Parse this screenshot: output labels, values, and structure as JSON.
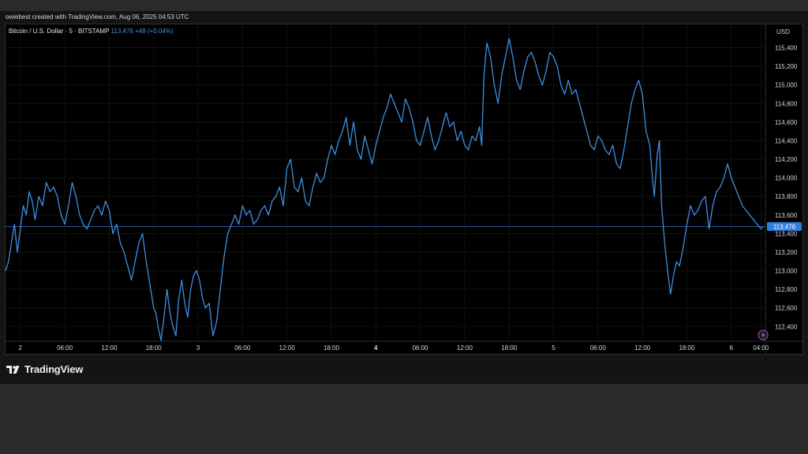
{
  "header": {
    "credit": "owiebest created with TradingView.com, Aug 06, 2025 04:53 UTC"
  },
  "legend": {
    "symbol": "Bitcoin / U.S. Dollar · 5 · BITSTAMP",
    "last": "113,476",
    "change": "+48 (+0.04%)"
  },
  "logo": {
    "brand": "TradingView",
    "icon": "tradingview-logo-icon"
  },
  "colors": {
    "line": "#3d8fe0",
    "price_tag": "#2f7fe0",
    "background": "#000000"
  },
  "chart_data": {
    "type": "line",
    "currency": "USD",
    "last_price": 113476,
    "last_price_label": "113,476",
    "ylim": [
      112250,
      115650
    ],
    "y_ticks": [
      {
        "value": 115400,
        "label": "115,400"
      },
      {
        "value": 115200,
        "label": "115,200"
      },
      {
        "value": 115000,
        "label": "115,000"
      },
      {
        "value": 114800,
        "label": "114,800"
      },
      {
        "value": 114600,
        "label": "114,600"
      },
      {
        "value": 114400,
        "label": "114,400"
      },
      {
        "value": 114200,
        "label": "114,200"
      },
      {
        "value": 114000,
        "label": "114,000"
      },
      {
        "value": 113800,
        "label": "113,800"
      },
      {
        "value": 113600,
        "label": "113,600"
      },
      {
        "value": 113400,
        "label": "113,400"
      },
      {
        "value": 113200,
        "label": "113,200"
      },
      {
        "value": 113000,
        "label": "113,000"
      },
      {
        "value": 112800,
        "label": "112,800"
      },
      {
        "value": 112600,
        "label": "112,600"
      },
      {
        "value": 112400,
        "label": "112,400"
      }
    ],
    "xlim": [
      -2,
      100.5
    ],
    "x_ticks": [
      {
        "value": 0,
        "label": "2",
        "bold": false
      },
      {
        "value": 6,
        "label": "06:00",
        "bold": false
      },
      {
        "value": 12,
        "label": "12:00",
        "bold": false
      },
      {
        "value": 18,
        "label": "18:00",
        "bold": false
      },
      {
        "value": 24,
        "label": "3",
        "bold": false
      },
      {
        "value": 30,
        "label": "06:00",
        "bold": false
      },
      {
        "value": 36,
        "label": "12:00",
        "bold": false
      },
      {
        "value": 42,
        "label": "18:00",
        "bold": false
      },
      {
        "value": 48,
        "label": "4",
        "bold": true
      },
      {
        "value": 54,
        "label": "06:00",
        "bold": false
      },
      {
        "value": 60,
        "label": "12:00",
        "bold": false
      },
      {
        "value": 66,
        "label": "18:00",
        "bold": false
      },
      {
        "value": 72,
        "label": "5",
        "bold": false
      },
      {
        "value": 78,
        "label": "06:00",
        "bold": false
      },
      {
        "value": 84,
        "label": "12:00",
        "bold": false
      },
      {
        "value": 90,
        "label": "18:00",
        "bold": false
      },
      {
        "value": 96,
        "label": "6",
        "bold": false
      },
      {
        "value": 100,
        "label": "04:00",
        "bold": false
      }
    ],
    "series": [
      {
        "x": [
          -2,
          -1.6,
          -1.2,
          -0.8,
          -0.4,
          0,
          0.4,
          0.8,
          1.2,
          1.6,
          2,
          2.5,
          3,
          3.5,
          4,
          4.5,
          5,
          5.5,
          6,
          6.5,
          7,
          7.5,
          8,
          8.5,
          9,
          9.5,
          10,
          10.5,
          11,
          11.5,
          12,
          12.5,
          13,
          13.5,
          14,
          14.5,
          15,
          15.5,
          16,
          16.5,
          17,
          17.5,
          18,
          18.3,
          18.6,
          19,
          19.4,
          19.8,
          20.2,
          20.6,
          21,
          21.4,
          21.8,
          22.2,
          22.6,
          23,
          23.4,
          23.8,
          24.2,
          24.6,
          25,
          25.5,
          26,
          26.5,
          27,
          27.5,
          28,
          28.5,
          29,
          29.5,
          30,
          30.5,
          31,
          31.5,
          32,
          32.5,
          33,
          33.5,
          34,
          34.5,
          35,
          35.5,
          36,
          36.5,
          37,
          37.5,
          38,
          38.5,
          39,
          39.5,
          40,
          40.5,
          41,
          41.5,
          42,
          42.5,
          43,
          43.5,
          44,
          44.5,
          45,
          45.5,
          46,
          46.5,
          47,
          47.5,
          48,
          48.5,
          49,
          49.5,
          50,
          50.5,
          51,
          51.5,
          52,
          52.5,
          53,
          53.5,
          54,
          54.5,
          55,
          55.5,
          56,
          56.5,
          57,
          57.5,
          58,
          58.5,
          59,
          59.5,
          60,
          60.5,
          61,
          61.5,
          62,
          62.3,
          62.6,
          63,
          63.5,
          64,
          64.5,
          65,
          65.5,
          66,
          66.5,
          67,
          67.5,
          68,
          68.5,
          69,
          69.5,
          70,
          70.5,
          71,
          71.5,
          72,
          72.5,
          73,
          73.5,
          74,
          74.5,
          75,
          75.5,
          76,
          76.5,
          77,
          77.5,
          78,
          78.5,
          79,
          79.5,
          80,
          80.5,
          81,
          81.5,
          82,
          82.5,
          83,
          83.5,
          84,
          84.5,
          85,
          85.3,
          85.6,
          86,
          86.3,
          86.6,
          87,
          87.4,
          87.8,
          88.2,
          88.6,
          89,
          89.5,
          90,
          90.5,
          91,
          91.5,
          92,
          92.5,
          93,
          93.5,
          94,
          94.5,
          95,
          95.5,
          96,
          96.5,
          97,
          97.5,
          98,
          98.5,
          99,
          99.5,
          100,
          100.3
        ],
        "y": [
          113000,
          113100,
          113300,
          113500,
          113200,
          113450,
          113700,
          113600,
          113850,
          113750,
          113550,
          113800,
          113700,
          113950,
          113850,
          113900,
          113800,
          113600,
          113500,
          113700,
          113950,
          113800,
          113600,
          113500,
          113450,
          113550,
          113650,
          113700,
          113600,
          113750,
          113650,
          113400,
          113500,
          113300,
          113200,
          113050,
          112900,
          113100,
          113300,
          113400,
          113100,
          112850,
          112600,
          112550,
          112400,
          112250,
          112500,
          112800,
          112550,
          112400,
          112300,
          112700,
          112900,
          112650,
          112500,
          112800,
          112950,
          113000,
          112900,
          112700,
          112600,
          112650,
          112300,
          112450,
          112800,
          113150,
          113400,
          113500,
          113600,
          113500,
          113700,
          113600,
          113650,
          113500,
          113550,
          113650,
          113700,
          113600,
          113750,
          113800,
          113900,
          113700,
          114100,
          114200,
          113900,
          113850,
          114000,
          113750,
          113700,
          113900,
          114050,
          113950,
          114000,
          114200,
          114350,
          114250,
          114400,
          114500,
          114650,
          114350,
          114600,
          114300,
          114200,
          114450,
          114300,
          114150,
          114350,
          114500,
          114650,
          114750,
          114900,
          114800,
          114700,
          114600,
          114850,
          114750,
          114600,
          114400,
          114350,
          114500,
          114650,
          114450,
          114300,
          114400,
          114550,
          114700,
          114550,
          114600,
          114400,
          114500,
          114350,
          114300,
          114450,
          114400,
          114550,
          114350,
          115100,
          115450,
          115300,
          115000,
          114800,
          115100,
          115300,
          115500,
          115300,
          115050,
          114950,
          115150,
          115300,
          115350,
          115250,
          115100,
          115000,
          115150,
          115350,
          115300,
          115200,
          115000,
          114900,
          115050,
          114900,
          114950,
          114800,
          114650,
          114500,
          114350,
          114300,
          114450,
          114400,
          114300,
          114250,
          114350,
          114150,
          114100,
          114300,
          114550,
          114800,
          114950,
          115050,
          114900,
          114500,
          114350,
          114050,
          113800,
          114250,
          114400,
          113700,
          113300,
          113000,
          112750,
          112950,
          113100,
          113050,
          113250,
          113500,
          113700,
          113600,
          113650,
          113750,
          113800,
          113450,
          113700,
          113850,
          113900,
          114000,
          114150,
          114000,
          113900,
          113800,
          113700,
          113650,
          113600,
          113550,
          113500,
          113450,
          113476
        ]
      }
    ]
  }
}
